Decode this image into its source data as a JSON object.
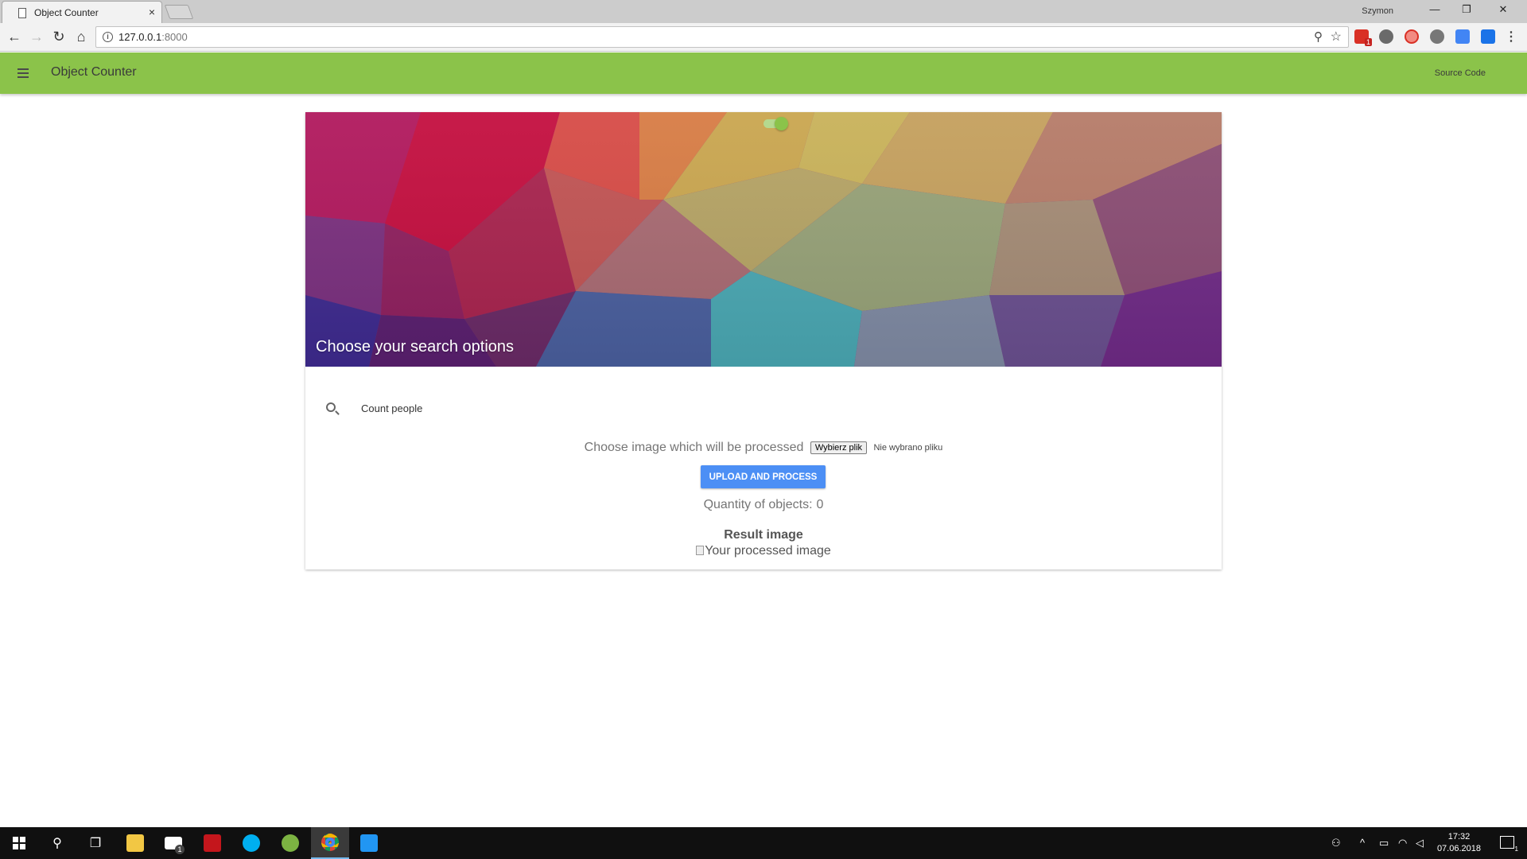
{
  "browser": {
    "tab_title": "Object Counter",
    "tab_close": "×",
    "profile_name": "Szymon",
    "window_controls": {
      "minimize": "—",
      "restore": "❐",
      "close": "✕"
    },
    "nav": {
      "back": "←",
      "forward": "→",
      "reload": "↻",
      "home": "⌂"
    },
    "url_host": "127.0.0.1",
    "url_port": ":8000",
    "gmail_badge": "1",
    "menu_icon": "⋮"
  },
  "app": {
    "title": "Object Counter",
    "source_code_link": "Source Code"
  },
  "card": {
    "hero_title": "Choose your search options",
    "option_label": "Count people",
    "option_enabled": true,
    "upload_prompt": "Choose image which will be processed",
    "file_button": "Wybierz plik",
    "no_file_text": "Nie wybrano pliku",
    "upload_button": "UPLOAD AND PROCESS",
    "quantity_label": "Quantity of objects:",
    "quantity_value": "0",
    "result_title": "Result image",
    "result_alt": "Your processed image"
  },
  "taskbar": {
    "time": "17:32",
    "date": "07.06.2018",
    "mail_badge": "1",
    "notification_count": "1",
    "accent": "#76b9ed"
  },
  "colors": {
    "appbar": "#8bc34a",
    "primary_button": "#4c8ff5"
  }
}
